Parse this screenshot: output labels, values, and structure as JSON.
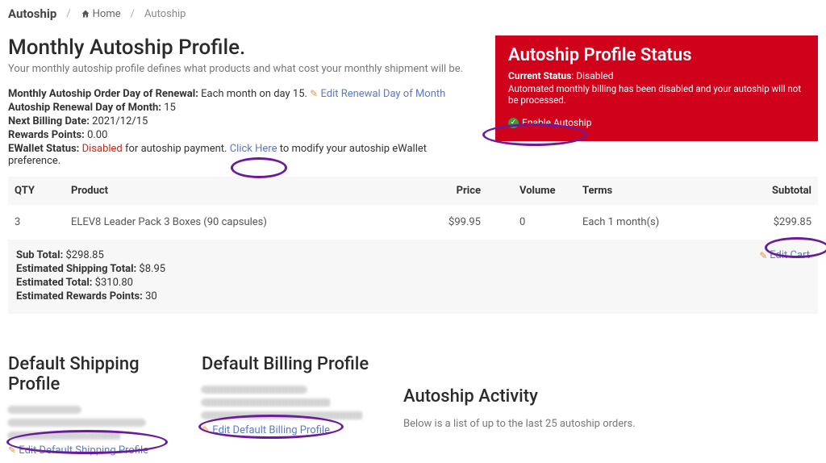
{
  "breadcrumb": {
    "page": "Autoship",
    "home": "Home",
    "current": "Autoship"
  },
  "header": {
    "title": "Monthly Autoship Profile.",
    "subtitle": "Your monthly autoship profile defines what products and what cost your monthly shipment will be."
  },
  "info": {
    "renewal_label": "Monthly Autoship Order Day of Renewal:",
    "renewal_value": "Each month on day 15.",
    "edit_renewal": "Edit Renewal Day of Month",
    "day_label": "Autoship Renewal Day of Month:",
    "day_value": "15",
    "next_label": "Next Billing Date:",
    "next_value": "2021/12/15",
    "rewards_label": "Rewards Points:",
    "rewards_value": "0.00",
    "ewallet_label": "EWallet Status:",
    "ewallet_status": "Disabled",
    "ewallet_mid": "for autoship payment.",
    "ewallet_link": "Click Here",
    "ewallet_tail": "to modify your autoship eWallet preference."
  },
  "status": {
    "title": "Autoship Profile Status",
    "current_label": "Current Status",
    "current_value": "Disabled",
    "desc": "Automated monthly billing has been disabled and your autoship will not be processed.",
    "enable": "Enable Autoship"
  },
  "table": {
    "headers": {
      "qty": "QTY",
      "product": "Product",
      "price": "Price",
      "volume": "Volume",
      "terms": "Terms",
      "subtotal": "Subtotal"
    },
    "rows": [
      {
        "qty": "3",
        "product": "ELEV8 Leader Pack 3 Boxes (90 capsules)",
        "price": "$99.95",
        "volume": "0",
        "terms": "Each 1 month(s)",
        "subtotal": "$299.85"
      }
    ]
  },
  "summary": {
    "subtotal_label": "Sub Total:",
    "subtotal": "$298.85",
    "ship_label": "Estimated Shipping Total:",
    "ship": "$8.95",
    "total_label": "Estimated Total:",
    "total": "$310.80",
    "rpoints_label": "Estimated Rewards Points:",
    "rpoints": "30",
    "edit_cart": "Edit Cart"
  },
  "shipping": {
    "title": "Default Shipping Profile",
    "edit": "Edit Default Shipping Profile"
  },
  "billing": {
    "title": "Default Billing Profile",
    "edit": "Edit Default Billing Profile"
  },
  "activity": {
    "title": "Autoship Activity",
    "desc": "Below is a list of up to the last 25 autoship orders."
  }
}
